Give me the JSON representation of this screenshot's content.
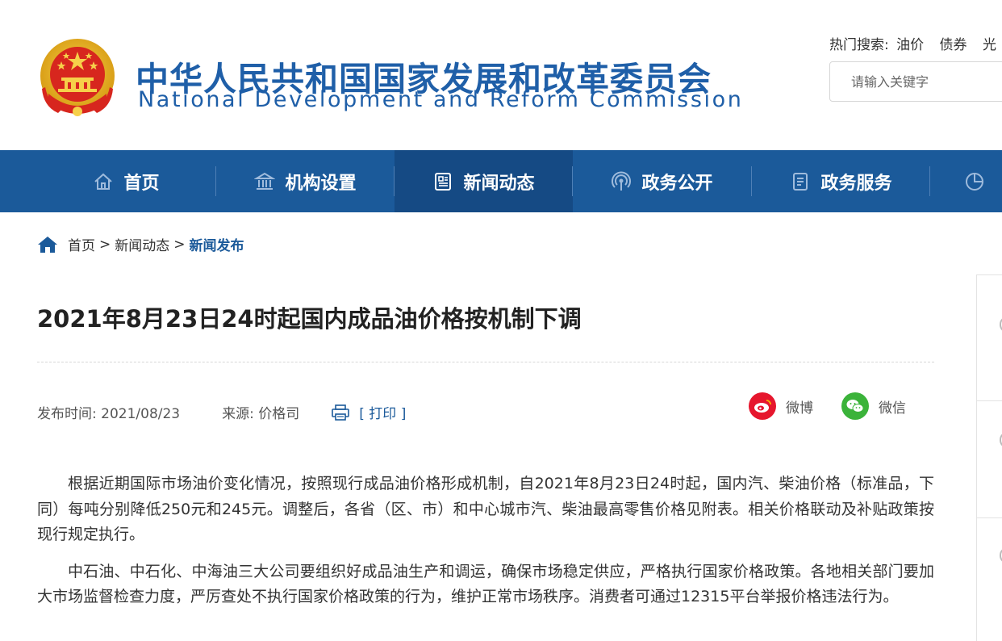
{
  "header": {
    "title_cn": "中华人民共和国国家发展和改革委员会",
    "title_en": "National Development and Reform Commission",
    "hot_search": {
      "label": "热门搜索:",
      "items": [
        "油价",
        "债券",
        "光"
      ]
    },
    "search": {
      "placeholder": "请输入关键字"
    }
  },
  "nav": {
    "items": [
      {
        "label": "首页",
        "icon": "home-icon"
      },
      {
        "label": "机构设置",
        "icon": "building-icon"
      },
      {
        "label": "新闻动态",
        "icon": "newspaper-icon"
      },
      {
        "label": "政务公开",
        "icon": "broadcast-icon"
      },
      {
        "label": "政务服务",
        "icon": "document-icon"
      },
      {
        "label": "",
        "icon": "pie-chart-icon"
      }
    ],
    "active_index": 2
  },
  "breadcrumb": {
    "items": [
      "首页",
      "新闻动态"
    ],
    "separator": ">",
    "current": "新闻发布"
  },
  "article": {
    "title": "2021年8月23日24时起国内成品油价格按机制下调",
    "publish_label": "发布时间:",
    "publish_date": "2021/08/23",
    "source_label": "来源:",
    "source": "价格司",
    "print_label": "[ 打印 ]",
    "share": [
      {
        "label": "微博",
        "icon": "weibo-icon",
        "color": "#e6162d"
      },
      {
        "label": "微信",
        "icon": "wechat-icon",
        "color": "#3bb33a"
      }
    ],
    "paragraphs": [
      "根据近期国际市场油价变化情况，按照现行成品油价格形成机制，自2021年8月23日24时起，国内汽、柴油价格（标准品，下同）每吨分别降低250元和245元。调整后，各省（区、市）和中心城市汽、柴油最高零售价格见附表。相关价格联动及补贴政策按现行规定执行。",
      "中石油、中石化、中海油三大公司要组织好成品油生产和调运，确保市场稳定供应，严格执行国家价格政策。各地相关部门要加大市场监督检查力度，严厉查处不执行国家价格政策的行为，维护正常市场秩序。消费者可通过12315平台举报价格违法行为。"
    ]
  },
  "colors": {
    "brand_blue": "#1f5fa8",
    "nav_bg": "#1b5a9a",
    "nav_active": "#154a84"
  }
}
